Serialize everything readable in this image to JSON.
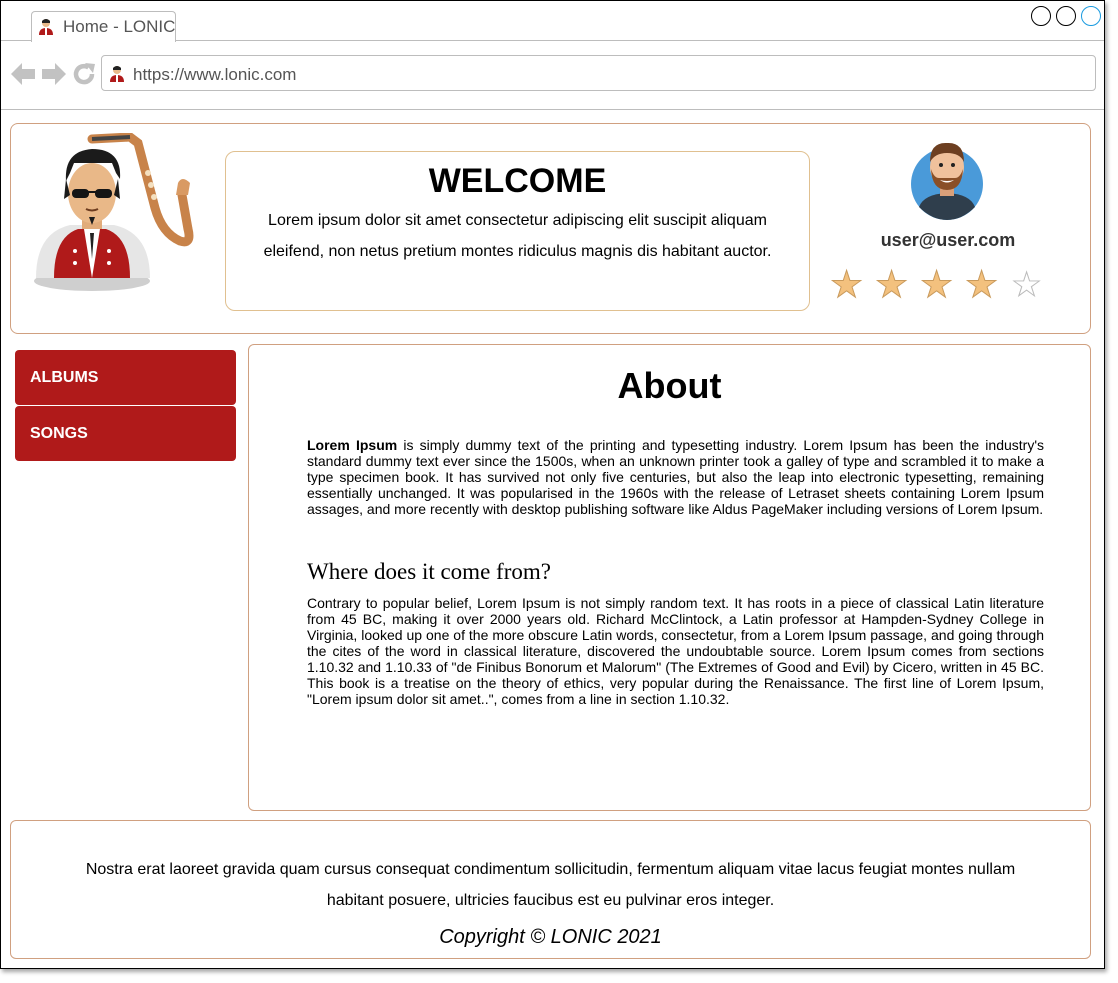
{
  "browser": {
    "tab_title": "Home - LONIC",
    "url": "https://www.lonic.com"
  },
  "header": {
    "welcome_title": "WELCOME",
    "welcome_text": "Lorem ipsum dolor sit amet consectetur adipiscing elit suscipit aliquam eleifend, non netus pretium montes ridiculus magnis dis habitant auctor.",
    "user_email": "user@user.com",
    "rating": {
      "value": 4,
      "max": 5,
      "filled_color": "#f3c17e",
      "empty_color": "#bbbbbb"
    }
  },
  "sidebar": {
    "items": [
      {
        "label": "ALBUMS"
      },
      {
        "label": "SONGS"
      }
    ],
    "color": "#b01a1a"
  },
  "main": {
    "title": "About",
    "intro_bold": "Lorem Ipsum",
    "intro_rest": " is simply dummy text of the printing and typesetting industry. Lorem Ipsum has been the industry's standard dummy text ever since the 1500s, when an unknown printer took a galley of type and scrambled it to make a type specimen book. It has survived not only five centuries, but also the leap into electronic typesetting, remaining essentially unchanged. It was popularised in the 1960s with the release of Letraset sheets containing Lorem Ipsum assages, and more recently with desktop publishing software like Aldus PageMaker including versions of Lorem Ipsum.",
    "subheading": "Where does it come from?",
    "body": "Contrary to popular belief, Lorem Ipsum is not simply random text. It has roots in a piece of classical Latin literature from 45 BC, making it over 2000 years old. Richard McClintock, a Latin professor at Hampden-Sydney College in Virginia, looked up one of the more obscure Latin words, consectetur, from a Lorem Ipsum passage, and going through the cites of the word in classical literature, discovered the undoubtable source. Lorem Ipsum comes from sections 1.10.32 and 1.10.33 of \"de Finibus Bonorum et Malorum\" (The Extremes of Good and Evil) by Cicero, written in 45 BC. This book is a treatise on the theory of ethics, very popular during the Renaissance. The first line of Lorem Ipsum, \"Lorem ipsum dolor sit amet..\", comes from a line in section 1.10.32."
  },
  "footer": {
    "text": "Nostra erat laoreet gravida quam cursus consequat condimentum sollicitudin, fermentum aliquam vitae lacus feugiat montes nullam habitant posuere, ultricies faucibus est eu pulvinar eros integer.",
    "copyright": "Copyright © LONIC 2021"
  },
  "icons": {
    "logo": "saxophone-player-logo",
    "avatar": "user-avatar-icon",
    "back": "back-arrow-icon",
    "forward": "forward-arrow-icon",
    "reload": "reload-icon"
  }
}
